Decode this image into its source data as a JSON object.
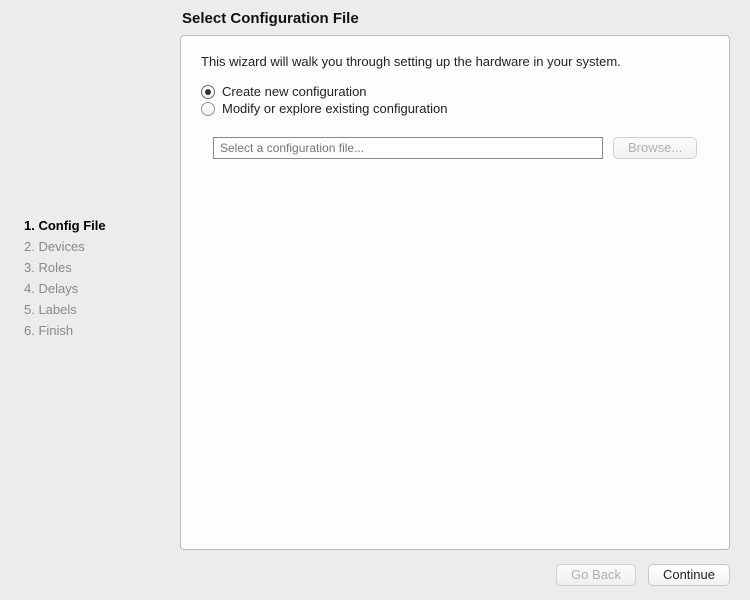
{
  "sidebar": {
    "steps": [
      {
        "label": "1. Config File",
        "active": true
      },
      {
        "label": "2. Devices",
        "active": false
      },
      {
        "label": "3. Roles",
        "active": false
      },
      {
        "label": "4. Delays",
        "active": false
      },
      {
        "label": "5. Labels",
        "active": false
      },
      {
        "label": "6. Finish",
        "active": false
      }
    ]
  },
  "page": {
    "title": "Select Configuration File",
    "intro": "This wizard will walk you through setting up the hardware in your system."
  },
  "options": {
    "create_label": "Create new configuration",
    "modify_label": "Modify or explore existing configuration",
    "selected": "create"
  },
  "file": {
    "placeholder": "Select a configuration file...",
    "value": "",
    "browse_label": "Browse..."
  },
  "footer": {
    "goback_label": "Go Back",
    "continue_label": "Continue"
  }
}
